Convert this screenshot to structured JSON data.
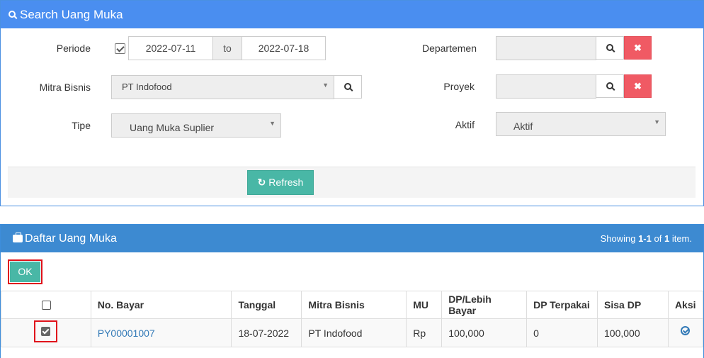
{
  "search_panel": {
    "title": "Search Uang Muka",
    "periode": {
      "label": "Periode",
      "checked": true,
      "from": "2022-07-11",
      "separator": "to",
      "to": "2022-07-18"
    },
    "mitra_bisnis": {
      "label": "Mitra Bisnis",
      "value": "PT Indofood"
    },
    "tipe": {
      "label": "Tipe",
      "value": "Uang Muka Suplier"
    },
    "departemen": {
      "label": "Departemen",
      "value": ""
    },
    "proyek": {
      "label": "Proyek",
      "value": ""
    },
    "aktif": {
      "label": "Aktif",
      "value": "Aktif"
    },
    "refresh_label": "Refresh",
    "clear_glyph": "✖"
  },
  "list_panel": {
    "title": "Daftar Uang Muka",
    "summary": {
      "prefix": "Showing",
      "range": "1-1",
      "of": "of",
      "total": "1",
      "suffix": "item."
    },
    "ok_label": "OK",
    "columns": [
      "No. Bayar",
      "Tanggal",
      "Mitra Bisnis",
      "MU",
      "DP/Lebih Bayar",
      "DP Terpakai",
      "Sisa DP",
      "Aksi"
    ],
    "rows": [
      {
        "checked": true,
        "no_bayar": "PY00001007",
        "tanggal": "18-07-2022",
        "mitra_bisnis": "PT Indofood",
        "mu": "Rp",
        "dp_lebih_bayar": "100,000",
        "dp_terpakai": "0",
        "sisa_dp": "100,000"
      }
    ]
  },
  "colors": {
    "header_blue": "#4a8ef0",
    "list_header_blue": "#3d8ad1",
    "teal_button": "#49b7a6",
    "clear_red": "#f05a64",
    "highlight_red": "#e0121b",
    "link_blue": "#337ab7"
  }
}
